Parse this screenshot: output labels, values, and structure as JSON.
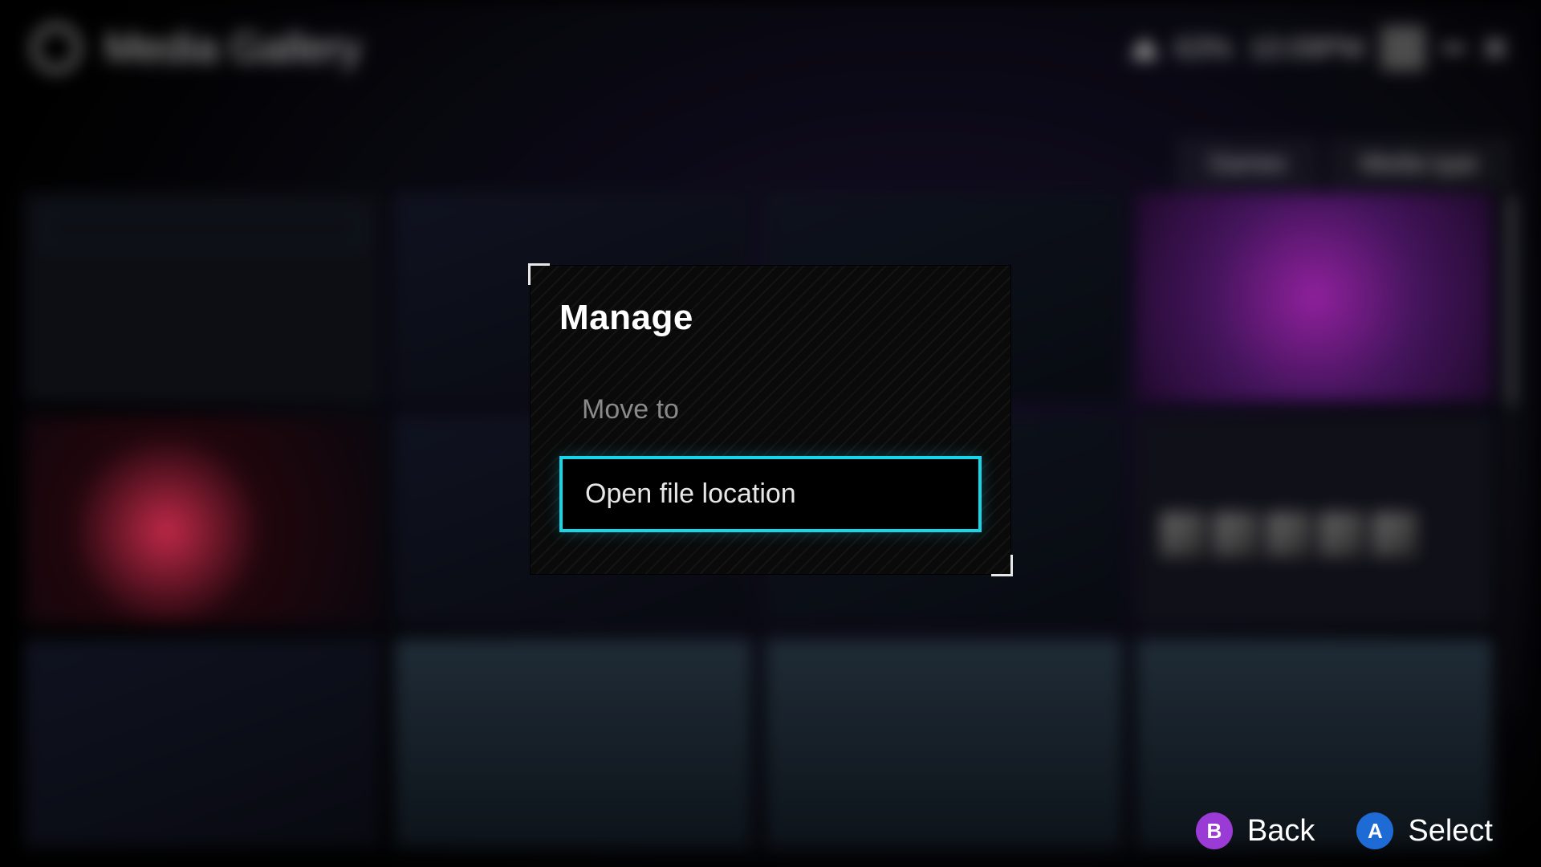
{
  "header": {
    "title": "Media Gallery",
    "battery_pct": "63%",
    "clock": "10:09PM"
  },
  "filters": {
    "games": "Games",
    "media_type": "Media type"
  },
  "modal": {
    "title": "Manage",
    "options": {
      "move_to": "Move to",
      "open_location": "Open file location"
    }
  },
  "hints": {
    "back_glyph": "B",
    "back_label": "Back",
    "select_glyph": "A",
    "select_label": "Select"
  }
}
